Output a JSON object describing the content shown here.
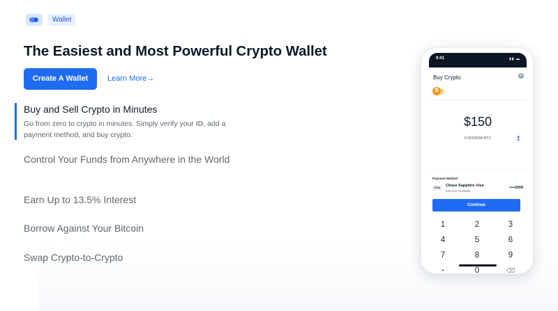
{
  "badge": {
    "icon": "wallet-toggle-icon",
    "label": "Wallet"
  },
  "hero": {
    "title": "The Easiest and Most Powerful Crypto Wallet",
    "cta_label": "Create A Wallet",
    "learn_more_label": "Learn More→"
  },
  "features": [
    {
      "title": "Buy and Sell Crypto in Minutes",
      "description": "Go from zero to crypto in minutes. Simply verify your ID, add a payment method, and buy crypto.",
      "active": true
    },
    {
      "title": "Control Your Funds from Anywhere in the World",
      "active": false
    },
    {
      "title": "Earn Up to 13.5% Interest",
      "active": false
    },
    {
      "title": "Borrow Against Your Bitcoin",
      "active": false
    },
    {
      "title": "Swap Crypto-to-Crypto",
      "active": false
    }
  ],
  "phone": {
    "time": "9:41",
    "sheet_title": "Buy Crypto",
    "coin_icon": "bitcoin-icon",
    "amount": "$150",
    "btc_amount": "0.0052568 BTC",
    "payment_method_label": "Payment Method",
    "card_brand": "VISA",
    "card_name": "Chase Sapphire Visa",
    "card_available": "$25,000 Available",
    "card_number": "••••2009",
    "continue_label": "Continue",
    "keys": [
      "1",
      "2",
      "3",
      "4",
      "5",
      "6",
      "7",
      "8",
      "9",
      "•",
      "0",
      "⌫"
    ]
  },
  "colors": {
    "accent": "#1f6cf2",
    "text": "#0b1a2b",
    "muted": "#5d6670"
  }
}
